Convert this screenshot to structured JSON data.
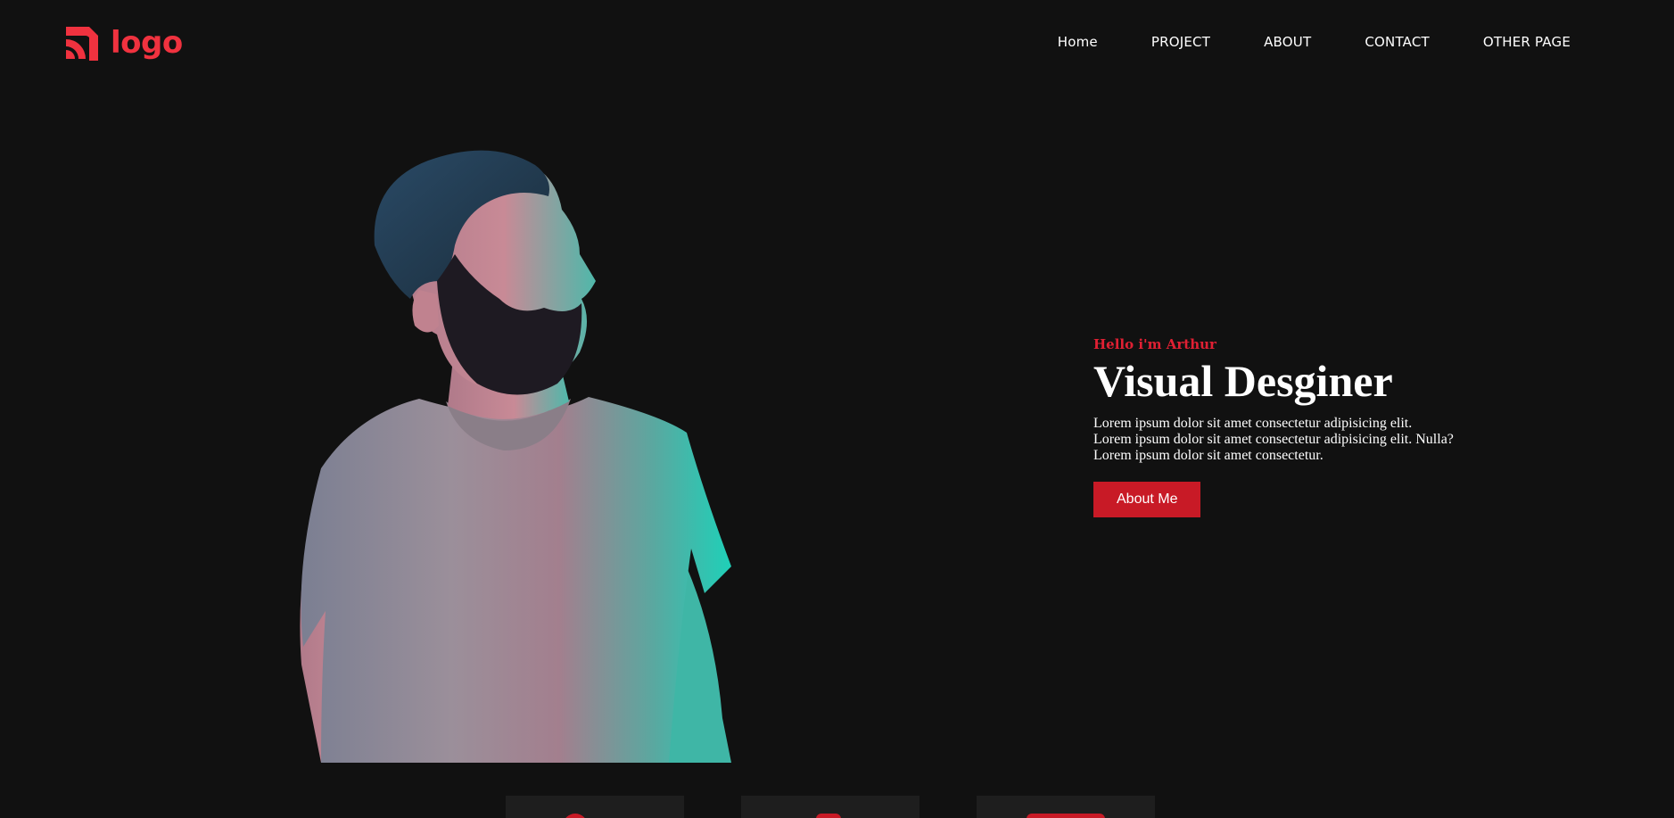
{
  "header": {
    "logo_text": "logo",
    "nav": [
      {
        "label": "Home"
      },
      {
        "label": "PROJECT"
      },
      {
        "label": "ABOUT"
      },
      {
        "label": "CONTACT"
      },
      {
        "label": "OTHER PAGE"
      }
    ]
  },
  "hero": {
    "greeting": "Hello i'm Arthur",
    "title": "Visual Desginer",
    "description_lines": [
      "Lorem ipsum dolor sit amet consectetur adipisicing elit.",
      "Lorem ipsum dolor sit amet consectetur adipisicing elit. Nulla?",
      "Lorem ipsum dolor sit amet consectetur."
    ],
    "button_label": "About Me"
  },
  "colors": {
    "background": "#111111",
    "accent": "#c81a26",
    "logo": "#f0323f"
  }
}
